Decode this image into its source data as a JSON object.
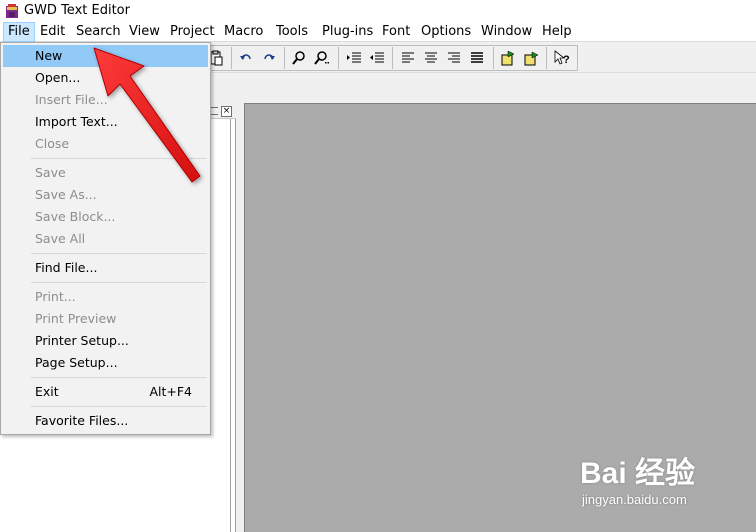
{
  "window": {
    "title": "GWD Text Editor",
    "icon": "app-book-icon"
  },
  "menubar": {
    "items": [
      "File",
      "Edit",
      "Search",
      "View",
      "Project",
      "Macro",
      "Tools",
      "Plug-ins",
      "Font",
      "Options",
      "Window",
      "Help"
    ],
    "active": "File"
  },
  "toolbar": {
    "buttons": [
      "paste-icon",
      "undo-icon",
      "redo-icon",
      "find-icon",
      "find-next-icon",
      "indent-icon",
      "outdent-icon",
      "align-left-icon",
      "align-center-icon",
      "align-right-icon",
      "justify-icon",
      "macro-record-icon",
      "macro-play-icon",
      "context-help-icon"
    ]
  },
  "file_menu": {
    "items": [
      {
        "label": "New",
        "enabled": true,
        "highlighted": true
      },
      {
        "label": "Open...",
        "enabled": true
      },
      {
        "label": "Insert File...",
        "enabled": false
      },
      {
        "label": "Import Text...",
        "enabled": true
      },
      {
        "label": "Close",
        "enabled": false
      },
      {
        "label": "Save",
        "enabled": false
      },
      {
        "label": "Save As...",
        "enabled": false
      },
      {
        "label": "Save Block...",
        "enabled": false
      },
      {
        "label": "Save All",
        "enabled": false
      },
      {
        "label": "Find File...",
        "enabled": true
      },
      {
        "label": "Print...",
        "enabled": false
      },
      {
        "label": "Print Preview",
        "enabled": false
      },
      {
        "label": "Printer Setup...",
        "enabled": true
      },
      {
        "label": "Page Setup...",
        "enabled": true
      },
      {
        "label": "Exit",
        "enabled": true,
        "shortcut": "Alt+F4"
      },
      {
        "label": "Favorite Files...",
        "enabled": true
      }
    ]
  },
  "watermark": {
    "logo": "Bai 经验",
    "url": "jingyan.baidu.com"
  },
  "colors": {
    "highlight": "#91c9f7",
    "arrow": "#ee1c1c",
    "editor_bg": "#ababab"
  }
}
